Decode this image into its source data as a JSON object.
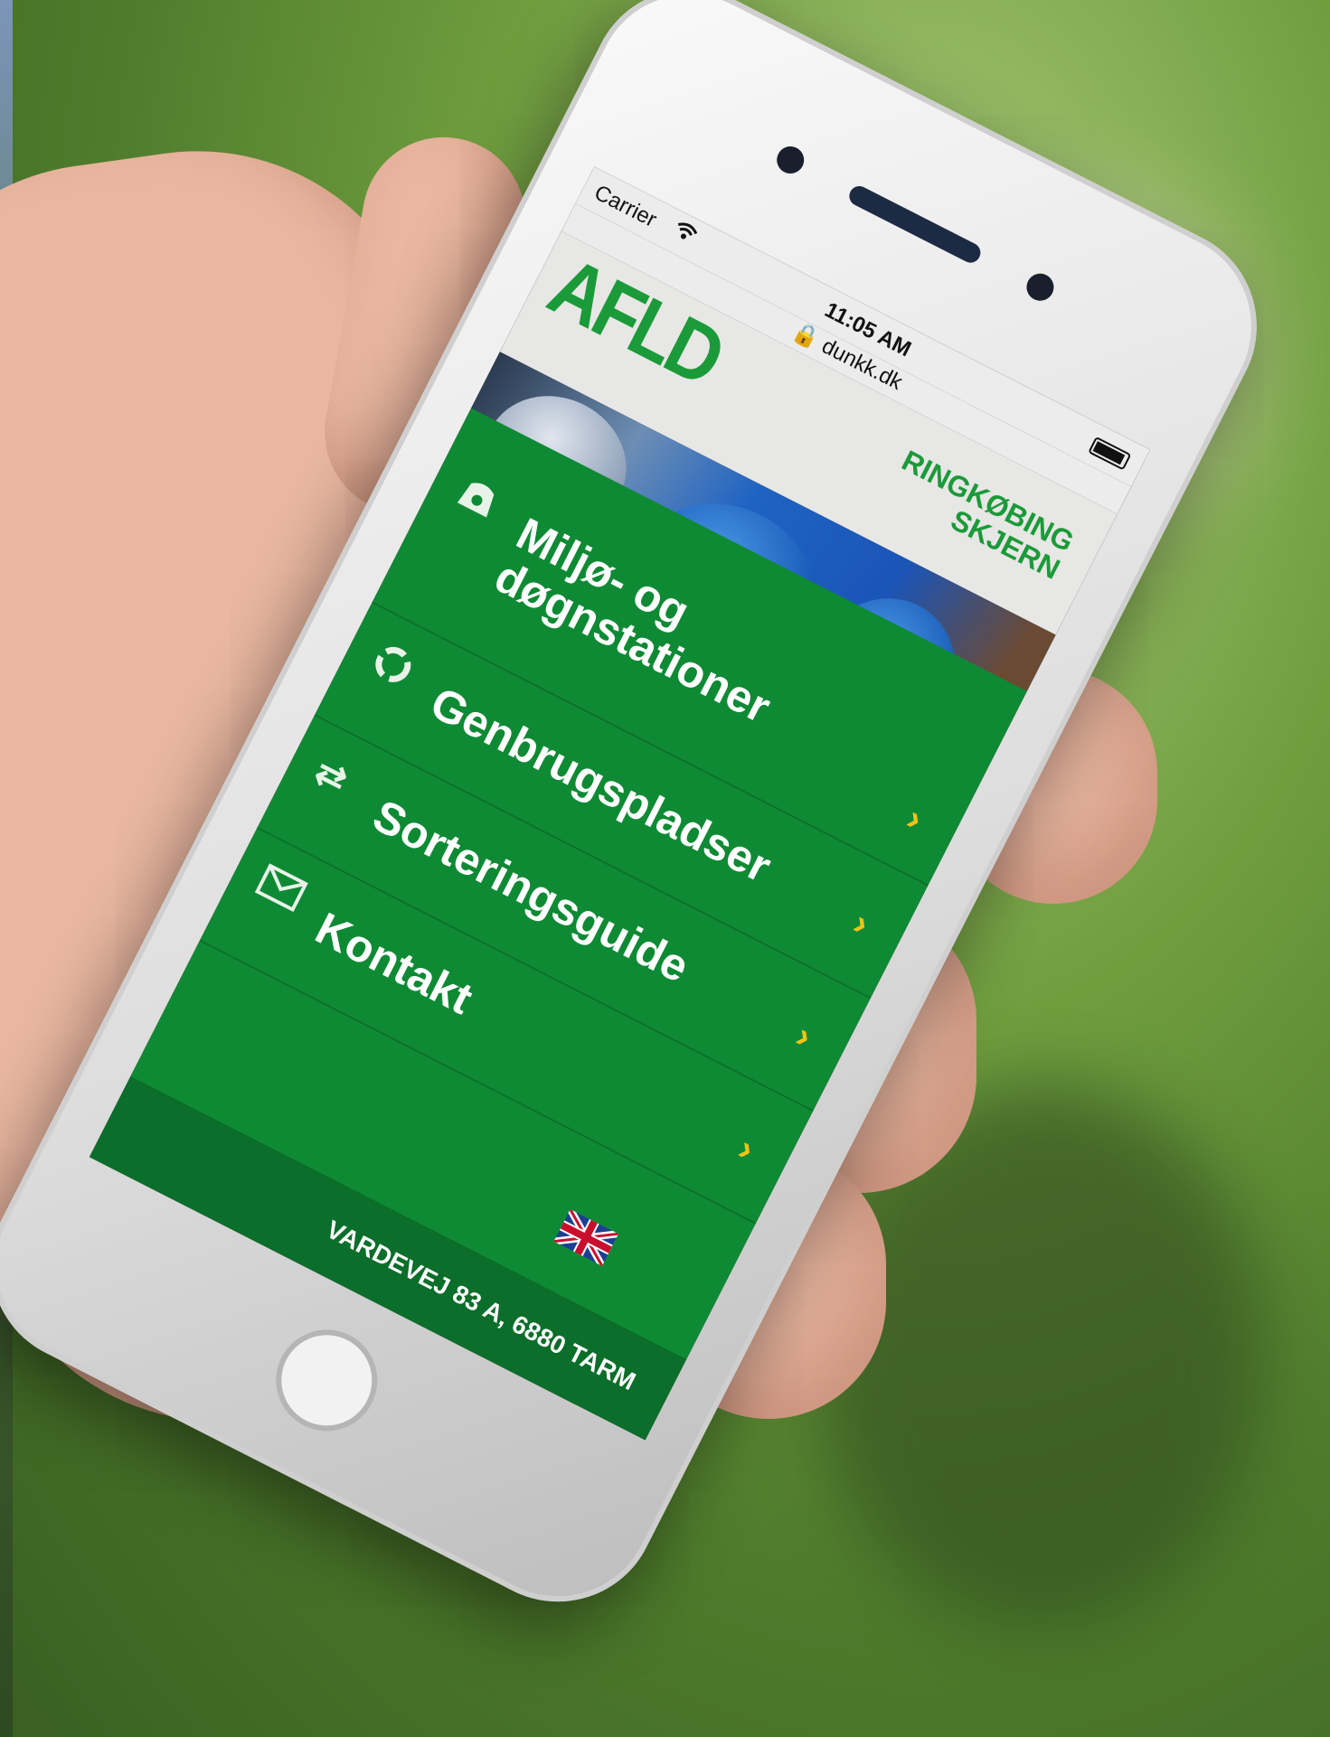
{
  "status_bar": {
    "carrier": "Carrier",
    "time": "11:05 AM",
    "wifi_icon": "wifi-icon",
    "battery_icon": "battery-icon"
  },
  "url_bar": {
    "url": "dunkk.dk",
    "lock_icon": "lock-icon"
  },
  "header": {
    "logo": "AFLD",
    "municipality": "RINGKØBING SKJERN"
  },
  "menu": {
    "items": [
      {
        "label": "Miljø- og døgnstationer",
        "icon": "bag-icon",
        "arrow_icon": "chevron-right-icon"
      },
      {
        "label": "Genbrugspladser",
        "icon": "recycle-icon",
        "arrow_icon": "chevron-right-icon"
      },
      {
        "label": "Sorteringsguide",
        "icon": "arrows-swap-icon",
        "arrow_icon": "chevron-right-icon"
      },
      {
        "label": "Kontakt",
        "icon": "envelope-icon",
        "arrow_icon": "chevron-right-icon"
      }
    ],
    "language_flag": "uk-flag-icon"
  },
  "footer": {
    "address": "VARDEVEJ 83 A, 6880 TARM"
  },
  "colors": {
    "brand_green": "#0f8a34",
    "accent_yellow": "#f1c316",
    "logo_green": "#1b9a39"
  }
}
